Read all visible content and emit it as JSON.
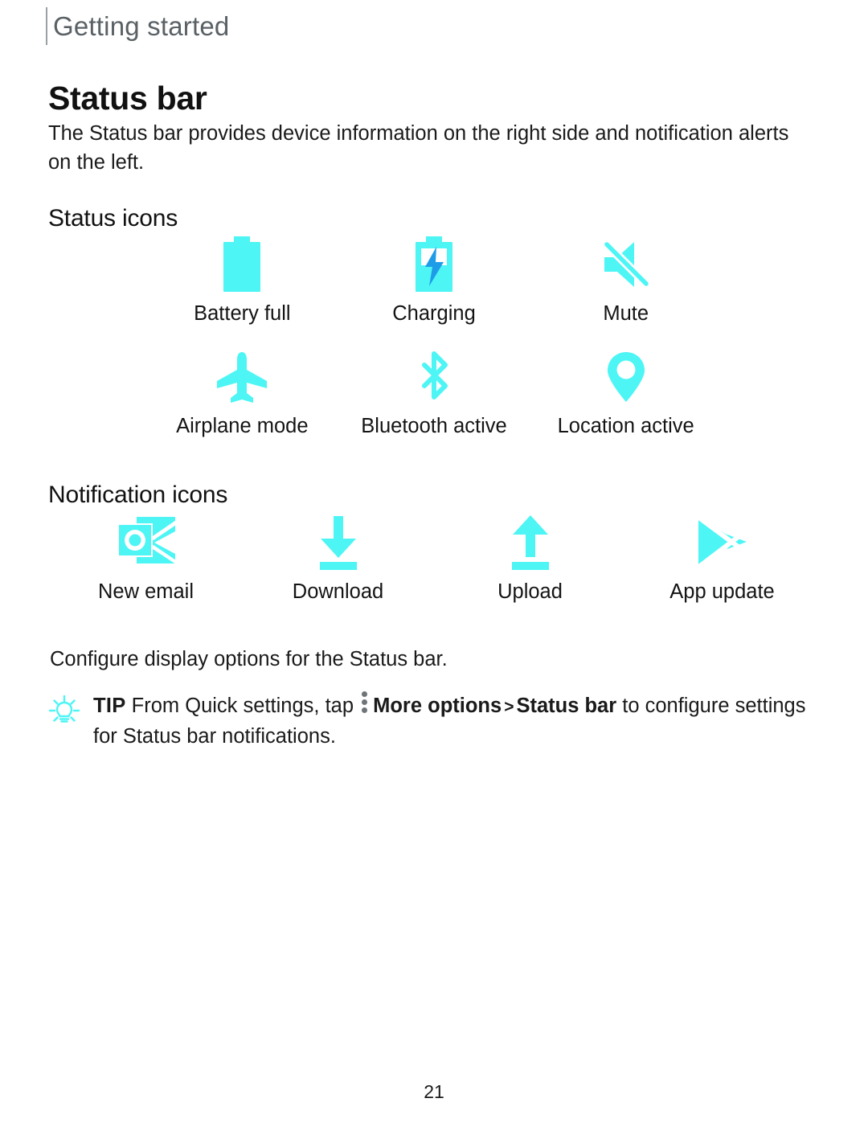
{
  "header": {
    "running_head": "Getting started"
  },
  "main": {
    "section_title": "Status bar",
    "intro": "The Status bar provides device information on the right side and notification alerts on the left.",
    "status_icons_heading": "Status icons",
    "notification_icons_heading": "Notification icons",
    "configure_line": "Configure display options for the Status bar.",
    "status_icons": [
      {
        "icon": "battery-full-icon",
        "label": "Battery full"
      },
      {
        "icon": "battery-charging-icon",
        "label": "Charging"
      },
      {
        "icon": "mute-icon",
        "label": "Mute"
      },
      {
        "icon": "airplane-mode-icon",
        "label": "Airplane mode"
      },
      {
        "icon": "bluetooth-active-icon",
        "label": "Bluetooth active"
      },
      {
        "icon": "location-active-icon",
        "label": "Location active"
      }
    ],
    "notification_icons": [
      {
        "icon": "new-email-icon",
        "label": "New email"
      },
      {
        "icon": "download-icon",
        "label": "Download"
      },
      {
        "icon": "upload-icon",
        "label": "Upload"
      },
      {
        "icon": "app-update-icon",
        "label": "App update"
      }
    ]
  },
  "tip": {
    "icon": "lightbulb-icon",
    "label": "TIP",
    "text_before": "From Quick settings, tap",
    "menu_icon": "more-options-kebab-icon",
    "bold_1": "More options",
    "separator": ">",
    "bold_2": "Status bar",
    "text_after": "to configure settings for Status bar notifications."
  },
  "footer": {
    "page_number": "21"
  },
  "colors": {
    "accent_cyan": "#4DF5F5",
    "charging_bolt_blue": "#1E9CE8",
    "header_gray": "#5A6165",
    "rule_gray": "#9AA0A3",
    "body_text": "#1A1A1A"
  }
}
